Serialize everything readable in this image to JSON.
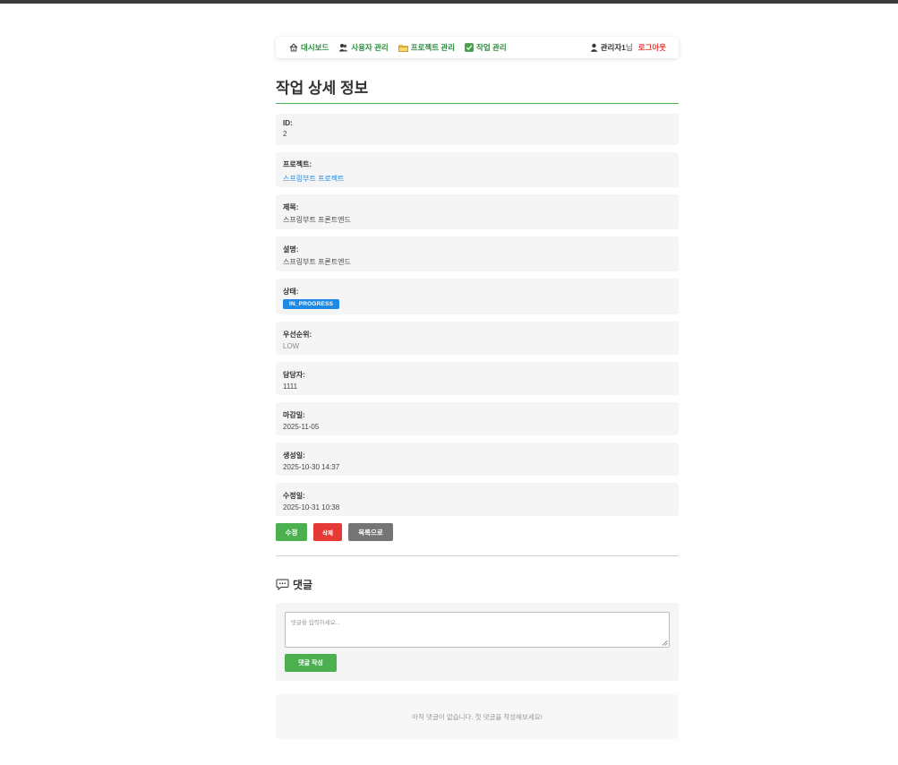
{
  "nav": {
    "links": [
      {
        "label": "대시보드",
        "icon": "home-icon"
      },
      {
        "label": "사용자 관리",
        "icon": "users-icon"
      },
      {
        "label": "프로젝트 관리",
        "icon": "folder-icon"
      },
      {
        "label": "작업 관리",
        "icon": "checkbox-icon"
      }
    ],
    "user_name": "관리자1",
    "user_suffix": "님",
    "logout": "로그아웃"
  },
  "page_title": "작업 상세 정보",
  "fields": {
    "id": {
      "label": "ID:",
      "value": "2"
    },
    "project": {
      "label": "프로젝트:",
      "value": "스프링부트 프로젝트"
    },
    "title": {
      "label": "제목:",
      "value": "스프링부트 프론트엔드"
    },
    "description": {
      "label": "설명:",
      "value": "스프링부트 프론트엔드"
    },
    "status": {
      "label": "상태:",
      "value": "IN_PROGRESS"
    },
    "priority": {
      "label": "우선순위:",
      "value": "LOW"
    },
    "assignee": {
      "label": "담당자:",
      "value": "1111"
    },
    "due_date": {
      "label": "마감일:",
      "value": "2025-11-05"
    },
    "created_at": {
      "label": "생성일:",
      "value": "2025-10-30 14:37"
    },
    "updated_at": {
      "label": "수정일:",
      "value": "2025-10-31 10:38"
    }
  },
  "actions": {
    "edit": "수정",
    "delete": "삭제",
    "list": "목록으로"
  },
  "comments": {
    "title": "댓글",
    "placeholder": "댓글을 입력하세요...",
    "submit": "댓글 작성",
    "empty": "아직 댓글이 없습니다. 첫 댓글을 작성해보세요!"
  },
  "colors": {
    "accent_green": "#4caf50",
    "link_blue": "#1e88e5",
    "danger_red": "#e53935",
    "neutral_gray": "#757575"
  }
}
